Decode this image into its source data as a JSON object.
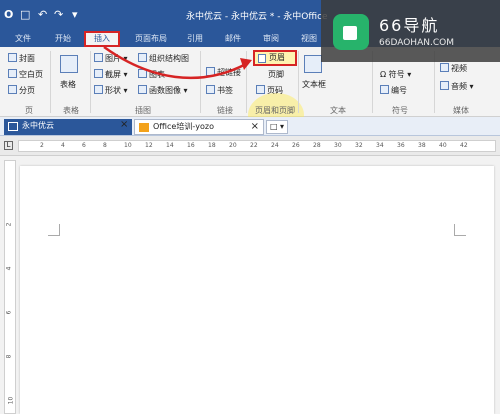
{
  "app": {
    "logo": "O",
    "title": "永中优云 - 永中优云 * - 永中Office"
  },
  "quick_access": [
    "save",
    "undo",
    "redo",
    "customize"
  ],
  "ribbon_tabs": [
    {
      "label": "文件",
      "active": false
    },
    {
      "label": "开始",
      "active": false
    },
    {
      "label": "插入",
      "active": true
    },
    {
      "label": "页面布局",
      "active": false
    },
    {
      "label": "引用",
      "active": false
    },
    {
      "label": "邮件",
      "active": false
    },
    {
      "label": "审阅",
      "active": false
    },
    {
      "label": "视图",
      "active": false
    }
  ],
  "ribbon": {
    "page_group": {
      "items": [
        "封面",
        "空白页",
        "分页"
      ],
      "label": "页"
    },
    "table_group": {
      "button": "表格",
      "label": "表格"
    },
    "illustration_group": {
      "items": [
        "图片",
        "截屏",
        "形状",
        "组织结构图",
        "图表",
        "函数图像"
      ],
      "label": "插图"
    },
    "link_group": {
      "items": [
        "超链接",
        "书签"
      ],
      "label": "链接"
    },
    "header_footer_group": {
      "items": [
        "页眉",
        "页脚",
        "页码"
      ],
      "label": "页眉和页脚"
    },
    "text_group": {
      "items": [
        "文本框"
      ],
      "label": "文本"
    },
    "symbol_group": {
      "items": [
        "符号",
        "编号"
      ],
      "label": "符号"
    },
    "media_group": {
      "items": [
        "视频",
        "音频"
      ],
      "label": "媒体"
    }
  },
  "watermark": {
    "title": "66导航",
    "subtitle": "66DAOHAN.COM"
  },
  "doc_tabs": [
    {
      "label": "永中优云",
      "active": true
    },
    {
      "label": "Office培训-yozo",
      "active": false
    }
  ],
  "ruler": {
    "corner": "L",
    "marks": [
      "2",
      "4",
      "6",
      "8",
      "10",
      "12",
      "14",
      "16",
      "18",
      "20",
      "22",
      "24",
      "26",
      "28",
      "30",
      "32",
      "34",
      "36",
      "38",
      "40",
      "42"
    ]
  },
  "vertical_ruler": {
    "marks": [
      "2",
      "4",
      "6",
      "8",
      "10"
    ]
  },
  "colors": {
    "brand": "#2b579a",
    "highlight": "#d62424",
    "accent": "#27b36b"
  }
}
